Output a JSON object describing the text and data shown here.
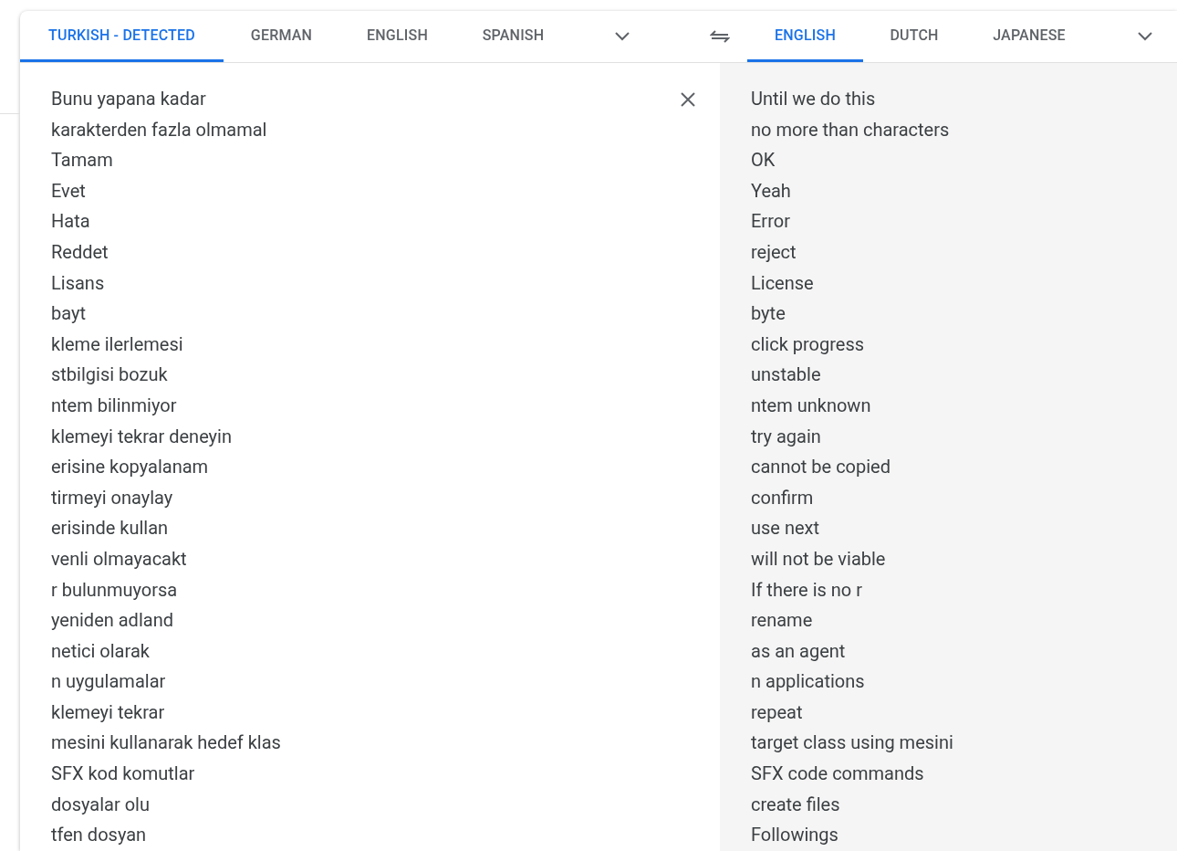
{
  "source_tabs": [
    {
      "label": "TURKISH - DETECTED",
      "selected": true
    },
    {
      "label": "GERMAN",
      "selected": false
    },
    {
      "label": "ENGLISH",
      "selected": false
    },
    {
      "label": "SPANISH",
      "selected": false
    }
  ],
  "target_tabs": [
    {
      "label": "ENGLISH",
      "selected": true
    },
    {
      "label": "DUTCH",
      "selected": false
    },
    {
      "label": "JAPANESE",
      "selected": false
    }
  ],
  "source_lines": [
    "Bunu yapana kadar",
    "karakterden fazla olmamal",
    "Tamam",
    "Evet",
    "Hata",
    "Reddet",
    "Lisans",
    "bayt",
    "kleme ilerlemesi",
    "stbilgisi bozuk",
    "ntem bilinmiyor",
    "klemeyi tekrar deneyin",
    "erisine kopyalanam",
    "tirmeyi onaylay",
    "erisinde kullan",
    "venli olmayacakt",
    "r bulunmuyorsa",
    "yeniden adland",
    "netici olarak",
    "n uygulamalar",
    "klemeyi tekrar",
    "mesini kullanarak hedef klas",
    "SFX kod komutlar",
    "dosyalar olu",
    "tfen dosyan"
  ],
  "translation_lines": [
    "Until we do this",
    "no more than characters",
    "OK",
    "Yeah",
    "Error",
    "reject",
    "License",
    "byte",
    "click progress",
    "unstable",
    "ntem unknown",
    "try again",
    "cannot be copied",
    "confirm",
    "use next",
    "will not be viable",
    "If there is no r",
    "rename",
    "as an agent",
    "n applications",
    "repeat",
    "target class using mesini",
    "SFX code commands",
    "create files",
    "Followings"
  ]
}
